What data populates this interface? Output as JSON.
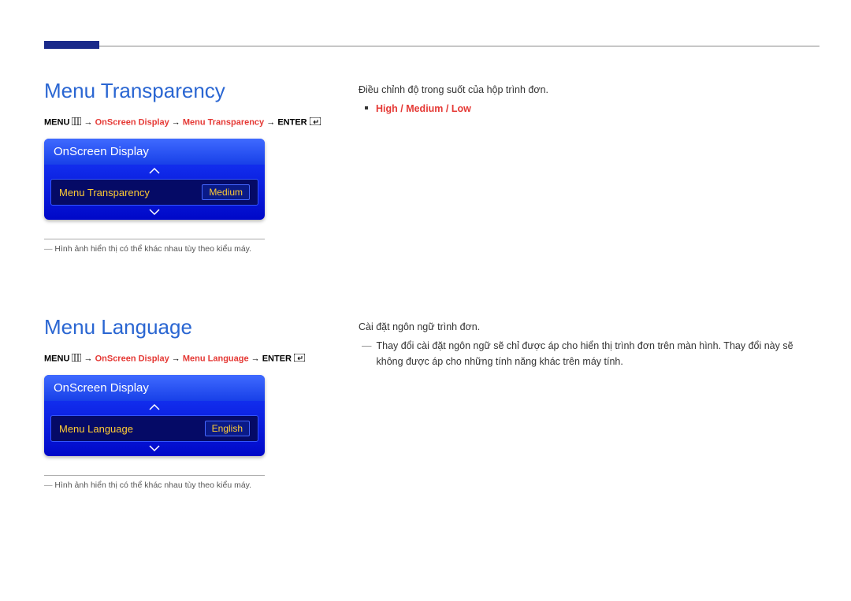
{
  "section1": {
    "title": "Menu Transparency",
    "breadcrumb": {
      "menu": "MENU",
      "arrow": " → ",
      "p1": "OnScreen Display",
      "p2": "Menu Transparency",
      "enter": "ENTER"
    },
    "osd": {
      "header": "OnScreen Display",
      "item_label": "Menu Transparency",
      "item_value": "Medium"
    },
    "footnote": "Hình ảnh hiển thị có thể khác nhau tùy theo kiểu máy."
  },
  "section2": {
    "title": "Menu Language",
    "breadcrumb": {
      "menu": "MENU",
      "arrow": " → ",
      "p1": "OnScreen Display",
      "p2": "Menu Language",
      "enter": "ENTER"
    },
    "osd": {
      "header": "OnScreen Display",
      "item_label": "Menu Language",
      "item_value": "English"
    },
    "footnote": "Hình ảnh hiển thị có thể khác nhau tùy theo kiểu máy."
  },
  "right1": {
    "desc": "Điều chỉnh độ trong suốt của hộp trình đơn.",
    "options": "High / Medium / Low"
  },
  "right2": {
    "desc": "Cài đặt ngôn ngữ trình đơn.",
    "note": "Thay đổi cài đặt ngôn ngữ sẽ chỉ được áp cho hiển thị trình đơn trên màn hình. Thay đổi này sẽ không được áp cho những tính năng khác trên máy tính."
  }
}
